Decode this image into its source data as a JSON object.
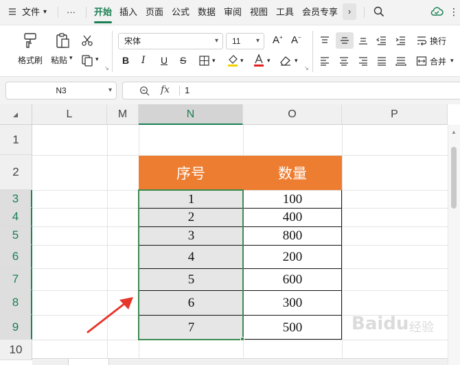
{
  "menubar": {
    "file": "文件",
    "more": "···",
    "tabs": [
      "开始",
      "插入",
      "页面",
      "公式",
      "数据",
      "审阅",
      "视图",
      "工具",
      "会员专享"
    ],
    "active_tab": "开始"
  },
  "ribbon": {
    "format_painter": "格式刷",
    "paste": "粘贴",
    "font_name": "宋体",
    "font_size": "11",
    "wrap_text": "换行",
    "merge": "合并"
  },
  "formula_bar": {
    "name_box": "N3",
    "fx": "fx",
    "value": "1"
  },
  "sheet": {
    "columns": [
      "L",
      "M",
      "N",
      "O",
      "P"
    ],
    "rows": [
      "1",
      "2",
      "3",
      "4",
      "5",
      "6",
      "7",
      "8",
      "9",
      "10"
    ],
    "selected_column": "N",
    "table": {
      "headers": [
        "序号",
        "数量"
      ],
      "rows": [
        [
          "1",
          "100"
        ],
        [
          "2",
          "400"
        ],
        [
          "3",
          "800"
        ],
        [
          "4",
          "200"
        ],
        [
          "5",
          "600"
        ],
        [
          "6",
          "300"
        ],
        [
          "7",
          "500"
        ]
      ]
    },
    "colors": {
      "header_fill": "#ed7d31",
      "selection": "#3b8a4f",
      "accent": "#1a7f52",
      "arrow": "#e8352a"
    }
  },
  "watermark": {
    "text": "Baidu",
    "suffix": "经验"
  }
}
